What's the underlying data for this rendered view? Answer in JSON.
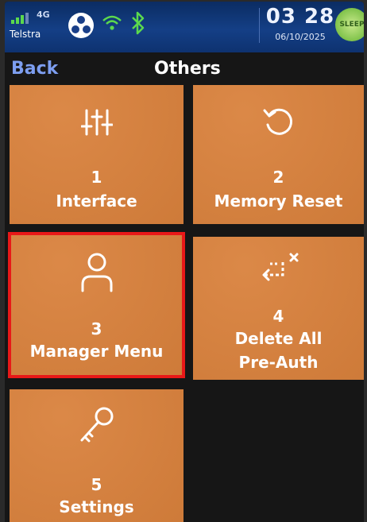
{
  "status": {
    "carrier": "Telstra",
    "network": "4G",
    "time": "03 28",
    "date": "06/10/2025",
    "badge": "SLEEP"
  },
  "header": {
    "back_label": "Back",
    "title": "Others"
  },
  "tiles": [
    {
      "number": "1",
      "label": "Interface",
      "icon": "sliders-icon"
    },
    {
      "number": "2",
      "label": "Memory Reset",
      "icon": "reset-icon"
    },
    {
      "number": "3",
      "label": "Manager Menu",
      "icon": "user-icon",
      "selected": true
    },
    {
      "number": "4",
      "label_line1": "Delete All",
      "label_line2": "Pre-Auth",
      "icon": "delete-preauth-icon"
    },
    {
      "number": "5",
      "label": "Settings",
      "icon": "key-icon"
    }
  ],
  "colors": {
    "tile": "#d9813c",
    "selection": "#e81818",
    "status_bar": "#143f86",
    "back_link": "#7d9ef0"
  }
}
